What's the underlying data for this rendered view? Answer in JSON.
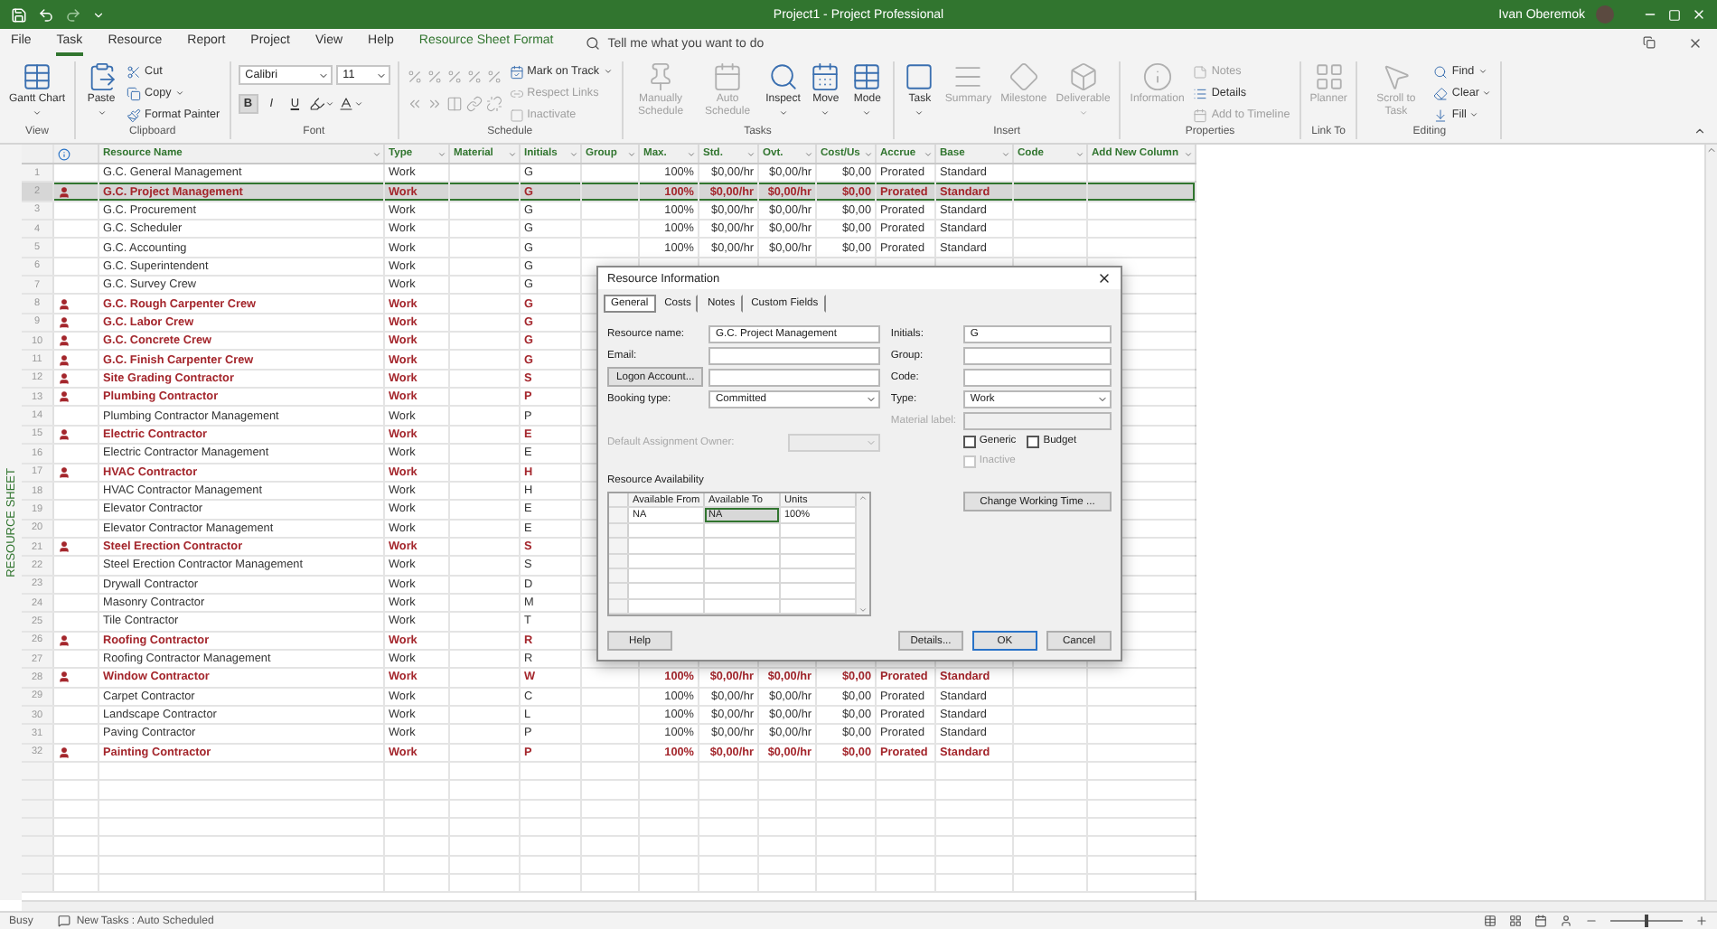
{
  "window": {
    "title": "Project1  -  Project Professional",
    "user": "Ivan Oberemok"
  },
  "tabs": [
    {
      "label": "File",
      "selected": false,
      "contextual": false
    },
    {
      "label": "Task",
      "selected": true,
      "contextual": false
    },
    {
      "label": "Resource",
      "selected": false,
      "contextual": false
    },
    {
      "label": "Report",
      "selected": false,
      "contextual": false
    },
    {
      "label": "Project",
      "selected": false,
      "contextual": false
    },
    {
      "label": "View",
      "selected": false,
      "contextual": false
    },
    {
      "label": "Help",
      "selected": false,
      "contextual": false
    },
    {
      "label": "Resource Sheet Format",
      "selected": false,
      "contextual": true
    }
  ],
  "tell_me": {
    "placeholder": "Tell me what you want to do"
  },
  "ribbon": {
    "groups": [
      {
        "label": "View",
        "columns": [
          [
            [
              {
                "kind": "large",
                "label": "Gantt Chart",
                "menu": true,
                "disabled": false
              }
            ]
          ]
        ]
      },
      {
        "label": "Clipboard",
        "columns": [
          [
            [
              {
                "kind": "large",
                "label": "Paste",
                "menu": true,
                "disabled": false
              }
            ]
          ],
          [
            [
              {
                "kind": "small",
                "label": "Cut",
                "menu": false,
                "disabled": false
              }
            ],
            [
              {
                "kind": "small",
                "label": "Copy",
                "menu": true,
                "disabled": false
              }
            ],
            [
              {
                "kind": "small",
                "label": "Format Painter",
                "menu": false,
                "disabled": false
              }
            ]
          ]
        ]
      },
      {
        "label": "Font",
        "columns": [
          [
            [
              {
                "kind": "combo",
                "value": "Calibri"
              },
              {
                "kind": "combo",
                "value": "11"
              }
            ],
            [
              {
                "kind": "glyph",
                "label": "B",
                "selected": true
              },
              {
                "kind": "glyph",
                "label": "I",
                "selected": false
              },
              {
                "kind": "glyph",
                "label": "U",
                "selected": false
              },
              {
                "kind": "icon",
                "menu": true,
                "disabled": false
              },
              {
                "kind": "icon",
                "menu": true,
                "disabled": false
              }
            ]
          ]
        ]
      },
      {
        "label": "Schedule",
        "columns": [
          [
            [
              {
                "kind": "icon",
                "menu": false,
                "disabled": true
              },
              {
                "kind": "icon",
                "menu": false,
                "disabled": true
              },
              {
                "kind": "icon",
                "menu": false,
                "disabled": true
              },
              {
                "kind": "icon",
                "menu": false,
                "disabled": true
              },
              {
                "kind": "icon",
                "menu": false,
                "disabled": true
              }
            ],
            [
              {
                "kind": "icon",
                "menu": false,
                "disabled": true
              },
              {
                "kind": "icon",
                "menu": false,
                "disabled": true
              },
              {
                "kind": "icon",
                "menu": false,
                "disabled": true
              },
              {
                "kind": "icon",
                "menu": false,
                "disabled": true
              },
              {
                "kind": "icon",
                "menu": false,
                "disabled": true
              }
            ]
          ],
          [
            [
              {
                "kind": "small",
                "label": "Mark on Track",
                "menu": true,
                "disabled": false
              }
            ],
            [
              {
                "kind": "small",
                "label": "Respect Links",
                "menu": false,
                "disabled": true
              }
            ],
            [
              {
                "kind": "small",
                "label": "Inactivate",
                "menu": false,
                "disabled": true
              }
            ]
          ]
        ]
      },
      {
        "label": "Tasks",
        "columns": [
          [
            [
              {
                "kind": "large",
                "label": "Manually Schedule",
                "menu": false,
                "disabled": true
              }
            ]
          ],
          [
            [
              {
                "kind": "large",
                "label": "Auto Schedule",
                "menu": false,
                "disabled": true
              }
            ]
          ],
          [
            [
              {
                "kind": "large",
                "label": "Inspect",
                "menu": true,
                "disabled": false
              }
            ]
          ],
          [
            [
              {
                "kind": "large",
                "label": "Move",
                "menu": true,
                "disabled": false
              }
            ]
          ],
          [
            [
              {
                "kind": "large",
                "label": "Mode",
                "menu": true,
                "disabled": false
              }
            ]
          ]
        ]
      },
      {
        "label": "Insert",
        "columns": [
          [
            [
              {
                "kind": "large",
                "label": "Task",
                "menu": true,
                "disabled": false
              }
            ]
          ],
          [
            [
              {
                "kind": "large",
                "label": "Summary",
                "menu": false,
                "disabled": true
              }
            ]
          ],
          [
            [
              {
                "kind": "large",
                "label": "Milestone",
                "menu": false,
                "disabled": true
              }
            ]
          ],
          [
            [
              {
                "kind": "large",
                "label": "Deliverable",
                "menu": true,
                "disabled": true
              }
            ]
          ]
        ]
      },
      {
        "label": "Properties",
        "columns": [
          [
            [
              {
                "kind": "large",
                "label": "Information",
                "menu": false,
                "disabled": true
              }
            ]
          ],
          [
            [
              {
                "kind": "small",
                "label": "Notes",
                "menu": false,
                "disabled": true
              }
            ],
            [
              {
                "kind": "small",
                "label": "Details",
                "menu": false,
                "disabled": false
              }
            ],
            [
              {
                "kind": "small",
                "label": "Add to Timeline",
                "menu": false,
                "disabled": true
              }
            ]
          ]
        ]
      },
      {
        "label": "Link To",
        "columns": [
          [
            [
              {
                "kind": "large",
                "label": "Planner",
                "menu": false,
                "disabled": true
              }
            ]
          ]
        ]
      },
      {
        "label": "Editing",
        "columns": [
          [
            [
              {
                "kind": "large",
                "label": "Scroll to Task",
                "menu": false,
                "disabled": true
              }
            ]
          ],
          [
            [
              {
                "kind": "small",
                "label": "Find",
                "menu": true,
                "disabled": false
              }
            ],
            [
              {
                "kind": "small",
                "label": "Clear",
                "menu": true,
                "disabled": false
              }
            ],
            [
              {
                "kind": "small",
                "label": "Fill",
                "menu": true,
                "disabled": false
              }
            ]
          ]
        ]
      }
    ]
  },
  "sheet_label": "RESOURCE SHEET",
  "table": {
    "columns": [
      "Resource Name",
      "Type",
      "Material",
      "Initials",
      "Group",
      "Max.",
      "Std.",
      "Ovt.",
      "Cost/Us",
      "Accrue",
      "Base",
      "Code",
      "Add New Column"
    ],
    "rows": [
      {
        "id": "1",
        "name": "G.C. General Management",
        "type": "Work",
        "initials": "G",
        "max": "100%",
        "std": "$0,00/hr",
        "ovt": "$0,00/hr",
        "cost_use": "$0,00",
        "accrue": "Prorated",
        "base": "Standard",
        "overallocated": false,
        "selected": false
      },
      {
        "id": "2",
        "name": "G.C. Project Management",
        "type": "Work",
        "initials": "G",
        "max": "100%",
        "std": "$0,00/hr",
        "ovt": "$0,00/hr",
        "cost_use": "$0,00",
        "accrue": "Prorated",
        "base": "Standard",
        "overallocated": true,
        "selected": true
      },
      {
        "id": "3",
        "name": "G.C. Procurement",
        "type": "Work",
        "initials": "G",
        "max": "100%",
        "std": "$0,00/hr",
        "ovt": "$0,00/hr",
        "cost_use": "$0,00",
        "accrue": "Prorated",
        "base": "Standard",
        "overallocated": false,
        "selected": false
      },
      {
        "id": "4",
        "name": "G.C. Scheduler",
        "type": "Work",
        "initials": "G",
        "max": "100%",
        "std": "$0,00/hr",
        "ovt": "$0,00/hr",
        "cost_use": "$0,00",
        "accrue": "Prorated",
        "base": "Standard",
        "overallocated": false,
        "selected": false
      },
      {
        "id": "5",
        "name": "G.C. Accounting",
        "type": "Work",
        "initials": "G",
        "max": "100%",
        "std": "$0,00/hr",
        "ovt": "$0,00/hr",
        "cost_use": "$0,00",
        "accrue": "Prorated",
        "base": "Standard",
        "overallocated": false,
        "selected": false
      },
      {
        "id": "6",
        "name": "G.C. Superintendent",
        "type": "Work",
        "initials": "G",
        "overallocated": false,
        "selected": false
      },
      {
        "id": "7",
        "name": "G.C. Survey Crew",
        "type": "Work",
        "initials": "G",
        "overallocated": false,
        "selected": false
      },
      {
        "id": "8",
        "name": "G.C. Rough Carpenter Crew",
        "type": "Work",
        "initials": "G",
        "overallocated": true,
        "selected": false
      },
      {
        "id": "9",
        "name": "G.C. Labor Crew",
        "type": "Work",
        "initials": "G",
        "overallocated": true,
        "selected": false
      },
      {
        "id": "10",
        "name": "G.C. Concrete Crew",
        "type": "Work",
        "initials": "G",
        "overallocated": true,
        "selected": false
      },
      {
        "id": "11",
        "name": "G.C. Finish Carpenter Crew",
        "type": "Work",
        "initials": "G",
        "overallocated": true,
        "selected": false
      },
      {
        "id": "12",
        "name": "Site Grading Contractor",
        "type": "Work",
        "initials": "S",
        "overallocated": true,
        "selected": false
      },
      {
        "id": "13",
        "name": "Plumbing Contractor",
        "type": "Work",
        "initials": "P",
        "overallocated": true,
        "selected": false
      },
      {
        "id": "14",
        "name": "Plumbing Contractor Management",
        "type": "Work",
        "initials": "P",
        "overallocated": false,
        "selected": false
      },
      {
        "id": "15",
        "name": "Electric Contractor",
        "type": "Work",
        "initials": "E",
        "overallocated": true,
        "selected": false
      },
      {
        "id": "16",
        "name": "Electric Contractor Management",
        "type": "Work",
        "initials": "E",
        "overallocated": false,
        "selected": false
      },
      {
        "id": "17",
        "name": "HVAC Contractor",
        "type": "Work",
        "initials": "H",
        "overallocated": true,
        "selected": false
      },
      {
        "id": "18",
        "name": "HVAC Contractor Management",
        "type": "Work",
        "initials": "H",
        "overallocated": false,
        "selected": false
      },
      {
        "id": "19",
        "name": "Elevator Contractor",
        "type": "Work",
        "initials": "E",
        "overallocated": false,
        "selected": false
      },
      {
        "id": "20",
        "name": "Elevator Contractor Management",
        "type": "Work",
        "initials": "E",
        "overallocated": false,
        "selected": false
      },
      {
        "id": "21",
        "name": "Steel Erection Contractor",
        "type": "Work",
        "initials": "S",
        "overallocated": true,
        "selected": false
      },
      {
        "id": "22",
        "name": "Steel Erection Contractor Management",
        "type": "Work",
        "initials": "S",
        "overallocated": false,
        "selected": false
      },
      {
        "id": "23",
        "name": "Drywall Contractor",
        "type": "Work",
        "initials": "D",
        "overallocated": false,
        "selected": false
      },
      {
        "id": "24",
        "name": "Masonry Contractor",
        "type": "Work",
        "initials": "M",
        "overallocated": false,
        "selected": false
      },
      {
        "id": "25",
        "name": "Tile Contractor",
        "type": "Work",
        "initials": "T",
        "overallocated": false,
        "selected": false
      },
      {
        "id": "26",
        "name": "Roofing Contractor",
        "type": "Work",
        "initials": "R",
        "overallocated": true,
        "selected": false
      },
      {
        "id": "27",
        "name": "Roofing Contractor Management",
        "type": "Work",
        "initials": "R",
        "overallocated": false,
        "selected": false
      },
      {
        "id": "28",
        "name": "Window Contractor",
        "type": "Work",
        "initials": "W",
        "max": "100%",
        "std": "$0,00/hr",
        "ovt": "$0,00/hr",
        "cost_use": "$0,00",
        "accrue": "Prorated",
        "base": "Standard",
        "overallocated": true,
        "selected": false
      },
      {
        "id": "29",
        "name": "Carpet Contractor",
        "type": "Work",
        "initials": "C",
        "max": "100%",
        "std": "$0,00/hr",
        "ovt": "$0,00/hr",
        "cost_use": "$0,00",
        "accrue": "Prorated",
        "base": "Standard",
        "overallocated": false,
        "selected": false
      },
      {
        "id": "30",
        "name": "Landscape Contractor",
        "type": "Work",
        "initials": "L",
        "max": "100%",
        "std": "$0,00/hr",
        "ovt": "$0,00/hr",
        "cost_use": "$0,00",
        "accrue": "Prorated",
        "base": "Standard",
        "overallocated": false,
        "selected": false
      },
      {
        "id": "31",
        "name": "Paving Contractor",
        "type": "Work",
        "initials": "P",
        "max": "100%",
        "std": "$0,00/hr",
        "ovt": "$0,00/hr",
        "cost_use": "$0,00",
        "accrue": "Prorated",
        "base": "Standard",
        "overallocated": false,
        "selected": false
      },
      {
        "id": "32",
        "name": "Painting Contractor",
        "type": "Work",
        "initials": "P",
        "max": "100%",
        "std": "$0,00/hr",
        "ovt": "$0,00/hr",
        "cost_use": "$0,00",
        "accrue": "Prorated",
        "base": "Standard",
        "overallocated": true,
        "selected": false
      }
    ]
  },
  "dialog": {
    "title": "Resource Information",
    "tabs": [
      {
        "label": "General",
        "selected": true
      },
      {
        "label": "Costs",
        "selected": false
      },
      {
        "label": "Notes",
        "selected": false
      },
      {
        "label": "Custom Fields",
        "selected": false
      }
    ],
    "fields_left": [
      {
        "kind": "text",
        "label": "Resource name:",
        "value": "G.C. Project Management",
        "disabled": false
      },
      {
        "kind": "text",
        "label": "Email:",
        "disabled": false
      },
      {
        "kind": "button",
        "label": "Logon Account...",
        "disabled": false
      },
      {
        "kind": "select",
        "label": "Booking type:",
        "value": "Committed",
        "disabled": false
      }
    ],
    "fields_right": [
      {
        "kind": "text",
        "label": "Initials:",
        "value": "G",
        "disabled": false
      },
      {
        "kind": "text",
        "label": "Group:",
        "disabled": false
      },
      {
        "kind": "text",
        "label": "Code:",
        "disabled": false
      },
      {
        "kind": "select",
        "label": "Type:",
        "value": "Work",
        "disabled": false
      },
      {
        "kind": "text",
        "label": "Material label:",
        "disabled": true
      }
    ],
    "checkboxes": [
      {
        "label": "Generic",
        "checked": false,
        "disabled": false
      },
      {
        "label": "Budget",
        "checked": false,
        "disabled": false
      },
      {
        "label": "Inactive",
        "checked": false,
        "disabled": true
      }
    ],
    "owner": {
      "label": "Default Assignment Owner:",
      "disabled": true
    },
    "availability": {
      "label": "Resource Availability",
      "columns": [
        "Available From",
        "Available To",
        "Units"
      ],
      "rows": [
        {
          "cells": [
            {
              "text": "NA",
              "selected": false
            },
            {
              "text": "NA",
              "selected": true
            },
            {
              "text": "100%",
              "selected": false
            }
          ]
        }
      ]
    },
    "change_button": "Change Working Time ...",
    "buttons": [
      {
        "label": "Help",
        "default": false
      },
      {
        "label": "Details...",
        "default": false
      },
      {
        "label": "OK",
        "default": true
      },
      {
        "label": "Cancel",
        "default": false
      }
    ]
  },
  "status_bar": {
    "state": "Busy",
    "new_tasks": "New Tasks : Auto Scheduled",
    "zoom": {
      "level": 0.5
    }
  }
}
